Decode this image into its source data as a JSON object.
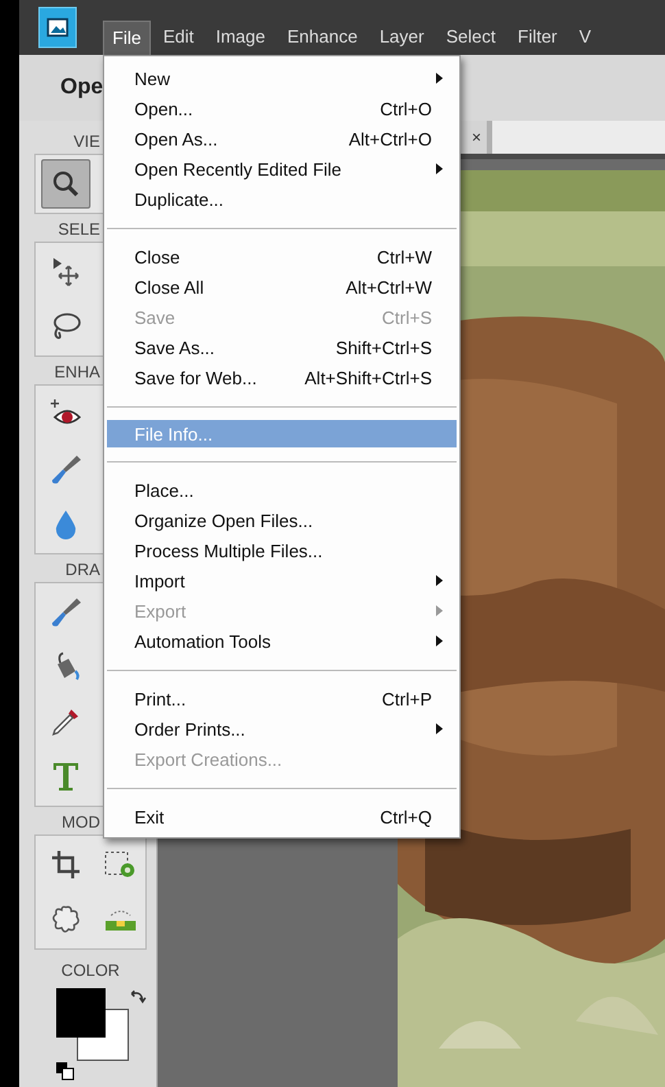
{
  "menubar": {
    "items": [
      {
        "label": "File",
        "selected": true
      },
      {
        "label": "Edit",
        "selected": false
      },
      {
        "label": "Image",
        "selected": false
      },
      {
        "label": "Enhance",
        "selected": false
      },
      {
        "label": "Layer",
        "selected": false
      },
      {
        "label": "Select",
        "selected": false
      },
      {
        "label": "Filter",
        "selected": false
      },
      {
        "label": "V",
        "selected": false
      }
    ]
  },
  "mode_title": "Ope",
  "document_tab": {
    "close": "×"
  },
  "toolbox": {
    "sections": [
      {
        "label": "VIE",
        "kind": "column",
        "tools": [
          {
            "kind": "zoom",
            "selected": true
          }
        ]
      },
      {
        "label": "SELE",
        "kind": "column",
        "tools": [
          {
            "kind": "move",
            "selected": false
          },
          {
            "kind": "lasso",
            "selected": false
          }
        ]
      },
      {
        "label": "ENHA",
        "kind": "column",
        "tools": [
          {
            "kind": "eye",
            "selected": false
          },
          {
            "kind": "brush",
            "selected": false
          },
          {
            "kind": "drop",
            "selected": false
          }
        ]
      },
      {
        "label": "DRA",
        "kind": "column",
        "tools": [
          {
            "kind": "brush",
            "selected": false
          },
          {
            "kind": "bucket",
            "selected": false
          },
          {
            "kind": "eyedropper",
            "selected": false
          },
          {
            "kind": "type",
            "selected": false
          }
        ]
      },
      {
        "label": "MOD",
        "kind": "grid",
        "tools": [
          {
            "kind": "crop",
            "selected": false
          },
          {
            "kind": "recompose",
            "selected": false
          },
          {
            "kind": "cookie",
            "selected": false
          },
          {
            "kind": "straighten",
            "selected": false
          }
        ]
      },
      {
        "label": "COLOR",
        "kind": "swatches"
      }
    ]
  },
  "file_menu": {
    "items": [
      {
        "kind": "item",
        "label": "New",
        "submenu": true,
        "disabled": false,
        "selected": false
      },
      {
        "kind": "item",
        "label": "Open...",
        "shortcut": "Ctrl+O",
        "submenu": false,
        "disabled": false,
        "selected": false
      },
      {
        "kind": "item",
        "label": "Open As...",
        "shortcut": "Alt+Ctrl+O",
        "submenu": false,
        "disabled": false,
        "selected": false
      },
      {
        "kind": "item",
        "label": "Open Recently Edited File",
        "submenu": true,
        "disabled": false,
        "selected": false
      },
      {
        "kind": "item",
        "label": "Duplicate...",
        "submenu": false,
        "disabled": false,
        "selected": false
      },
      {
        "kind": "separator"
      },
      {
        "kind": "item",
        "label": "Close",
        "shortcut": "Ctrl+W",
        "submenu": false,
        "disabled": false,
        "selected": false
      },
      {
        "kind": "item",
        "label": "Close All",
        "shortcut": "Alt+Ctrl+W",
        "submenu": false,
        "disabled": false,
        "selected": false
      },
      {
        "kind": "item",
        "label": "Save",
        "shortcut": "Ctrl+S",
        "submenu": false,
        "disabled": true,
        "selected": false
      },
      {
        "kind": "item",
        "label": "Save As...",
        "shortcut": "Shift+Ctrl+S",
        "submenu": false,
        "disabled": false,
        "selected": false
      },
      {
        "kind": "item",
        "label": "Save for Web...",
        "shortcut": "Alt+Shift+Ctrl+S",
        "submenu": false,
        "disabled": false,
        "selected": false
      },
      {
        "kind": "separator"
      },
      {
        "kind": "item",
        "label": "File Info...",
        "submenu": false,
        "disabled": false,
        "selected": true
      },
      {
        "kind": "separator"
      },
      {
        "kind": "item",
        "label": "Place...",
        "submenu": false,
        "disabled": false,
        "selected": false
      },
      {
        "kind": "item",
        "label": "Organize Open Files...",
        "submenu": false,
        "disabled": false,
        "selected": false
      },
      {
        "kind": "item",
        "label": "Process Multiple Files...",
        "submenu": false,
        "disabled": false,
        "selected": false
      },
      {
        "kind": "item",
        "label": "Import",
        "submenu": true,
        "disabled": false,
        "selected": false
      },
      {
        "kind": "item",
        "label": "Export",
        "submenu": true,
        "disabled": true,
        "selected": false
      },
      {
        "kind": "item",
        "label": "Automation Tools",
        "submenu": true,
        "disabled": false,
        "selected": false
      },
      {
        "kind": "separator"
      },
      {
        "kind": "item",
        "label": "Print...",
        "shortcut": "Ctrl+P",
        "submenu": false,
        "disabled": false,
        "selected": false
      },
      {
        "kind": "item",
        "label": "Order Prints...",
        "submenu": true,
        "disabled": false,
        "selected": false
      },
      {
        "kind": "item",
        "label": "Export Creations...",
        "submenu": false,
        "disabled": true,
        "selected": false
      },
      {
        "kind": "separator"
      },
      {
        "kind": "item",
        "label": "Exit",
        "shortcut": "Ctrl+Q",
        "submenu": false,
        "disabled": false,
        "selected": false
      }
    ]
  }
}
